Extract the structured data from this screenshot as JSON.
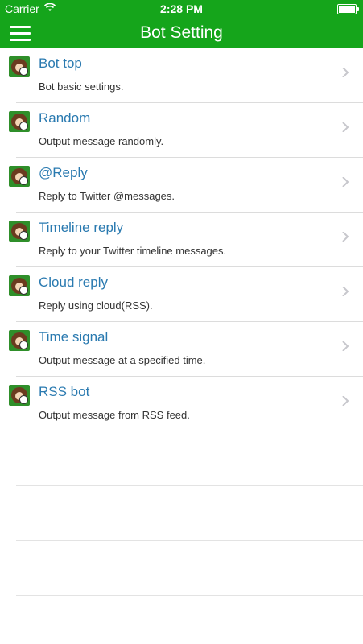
{
  "status": {
    "carrier": "Carrier",
    "time": "2:28 PM"
  },
  "navbar": {
    "title": "Bot Setting"
  },
  "items": [
    {
      "title": "Bot top",
      "subtitle": "Bot basic settings."
    },
    {
      "title": "Random",
      "subtitle": "Output message randomly."
    },
    {
      "title": "@Reply",
      "subtitle": "Reply to Twitter @messages."
    },
    {
      "title": "Timeline reply",
      "subtitle": "Reply to your Twitter timeline messages."
    },
    {
      "title": "Cloud reply",
      "subtitle": "Reply using cloud(RSS)."
    },
    {
      "title": "Time signal",
      "subtitle": "Output message at a specified time."
    },
    {
      "title": "RSS bot",
      "subtitle": "Output message from RSS feed."
    }
  ]
}
